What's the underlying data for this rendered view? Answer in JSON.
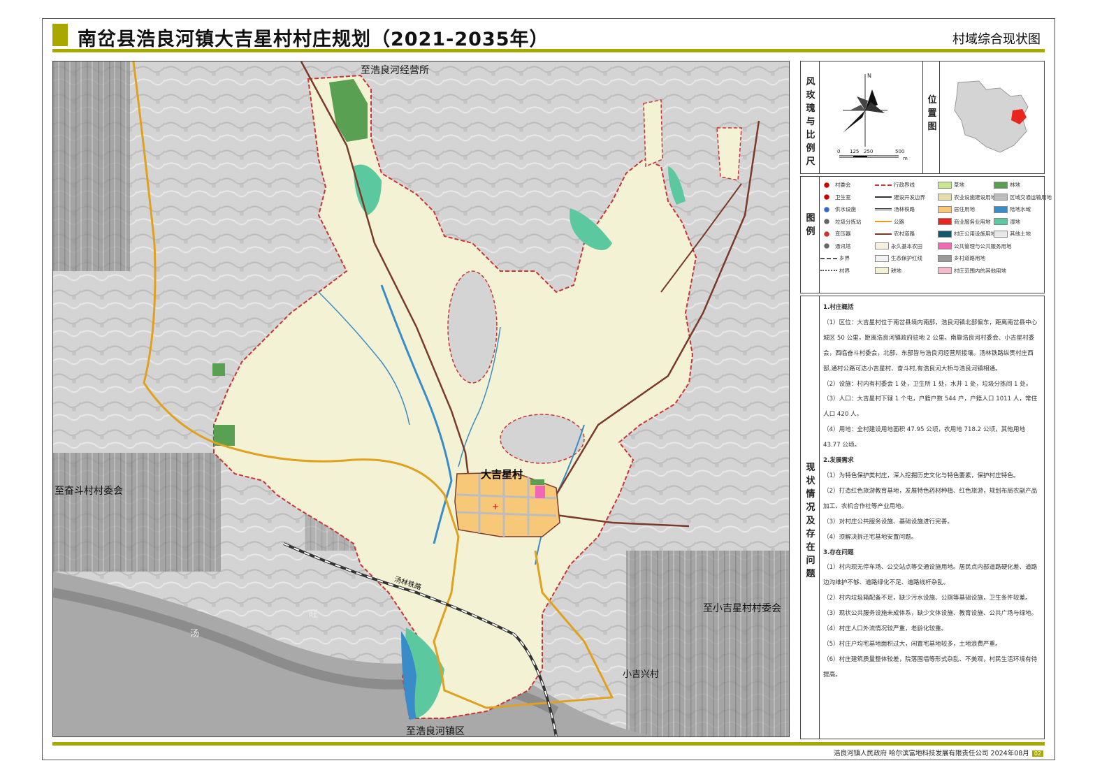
{
  "header": {
    "title": "南岔县浩良河镇大吉星村村庄规划（2021-2035年）",
    "subtitle": "村域综合现状图"
  },
  "map": {
    "labels": {
      "north_top": "至浩良河经营所",
      "west": "至奋斗村村委会",
      "east": "至小吉星村村委会",
      "south": "至浩良河镇区",
      "xiaojixing": "小吉兴村",
      "village": "大吉星村",
      "railway": "汤林铁路",
      "river1": "汤",
      "river2": "旺"
    }
  },
  "compass_panel": {
    "label": "风玫瑰与比例尺",
    "north": "N",
    "scale": [
      "0",
      "125",
      "250",
      "500"
    ],
    "scale_unit": "m"
  },
  "location_panel": {
    "label": "位置图"
  },
  "legend": {
    "label": "图例",
    "items": [
      {
        "text": "村委会",
        "kind": "point",
        "color": "#cc0000"
      },
      {
        "text": "卫生室",
        "kind": "point",
        "color": "#cc0000"
      },
      {
        "text": "供水设施",
        "kind": "point",
        "color": "#3366cc"
      },
      {
        "text": "垃圾分拣站",
        "kind": "point",
        "color": "#666666"
      },
      {
        "text": "变压器",
        "kind": "point",
        "color": "#cc3333"
      },
      {
        "text": "通讯塔",
        "kind": "point",
        "color": "#666666"
      },
      {
        "text": "乡界",
        "kind": "line-dash",
        "color": "#555555"
      },
      {
        "text": "村界",
        "kind": "line-dot",
        "color": "#555555"
      },
      {
        "text": "行政界线",
        "kind": "line-dash",
        "color": "#cc3333"
      },
      {
        "text": "建设开发边界",
        "kind": "line",
        "color": "#333333"
      },
      {
        "text": "汤林铁路",
        "kind": "rail",
        "color": "#333333"
      },
      {
        "text": "公路",
        "kind": "line",
        "color": "#e0a020"
      },
      {
        "text": "农村道路",
        "kind": "line",
        "color": "#7a3a2a"
      },
      {
        "text": "永久基本农田",
        "kind": "fill",
        "color": "#f7f0e0"
      },
      {
        "text": "生态保护红线",
        "kind": "fill",
        "color": "#f2f2f2"
      },
      {
        "text": "耕地",
        "kind": "fill",
        "color": "#f4f2d4"
      },
      {
        "text": "草地",
        "kind": "fill",
        "color": "#c8e88c"
      },
      {
        "text": "农业设施建设用地",
        "kind": "fill",
        "color": "#e6dcaa"
      },
      {
        "text": "居住用地",
        "kind": "fill",
        "color": "#f6c878"
      },
      {
        "text": "商业服务业用地",
        "kind": "fill",
        "color": "#e8261e"
      },
      {
        "text": "村庄公用设施用地",
        "kind": "fill",
        "color": "#0f5a6e"
      },
      {
        "text": "公共管理与公共服务用地",
        "kind": "fill",
        "color": "#f068b4"
      },
      {
        "text": "乡村道路用地",
        "kind": "fill",
        "color": "#999999"
      },
      {
        "text": "村庄范围内的其他用地",
        "kind": "fill",
        "color": "#f4b8c8"
      },
      {
        "text": "林地",
        "kind": "fill",
        "color": "#5aa052"
      },
      {
        "text": "区域交通运输用地",
        "kind": "fill",
        "color": "#bdbdbd"
      },
      {
        "text": "陆地水域",
        "kind": "fill",
        "color": "#3a8cc8"
      },
      {
        "text": "湿地",
        "kind": "fill",
        "color": "#5cc8a0"
      },
      {
        "text": "其他土地",
        "kind": "fill",
        "color": "#e8e8e8"
      }
    ]
  },
  "description": {
    "label": "现状情况及存在问题",
    "paragraphs": [
      {
        "type": "h",
        "text": "1.村庄概括"
      },
      {
        "type": "p",
        "text": "（1）区位：大吉星村位于南岔县境内南部，浩良河镇北部偏东，距离南岔县中心城区 50 公里，距离浩良河镇政府驻地 2 公里。南靠浩良河村委会、小吉星村委会，西临奋斗村委会，北部、东部皆与浩良河经营所接壤。汤林铁路纵贯村庄西部,通村公路可达小吉星村、奋斗村,有浩良河大桥与浩良河镇相通。"
      },
      {
        "type": "p",
        "text": "（2）设施：村内有村委会 1 处，卫生所 1 处，水井 1 处，垃圾分拣间 1 处。"
      },
      {
        "type": "p",
        "text": "（3）人口：大吉星村下辖 1 个屯，户籍户数 544 户，户籍人口 1011 人，常住人口 420 人。"
      },
      {
        "type": "p",
        "text": "（4）用地：全村建设用地面积 47.95 公顷，农用地 718.2 公顷，其他用地 43.77 公顷。"
      },
      {
        "type": "h",
        "text": "2.发展需求"
      },
      {
        "type": "p",
        "text": "（1）为特色保护类村庄，深入挖掘历史文化与特色要素，保护村庄特色。"
      },
      {
        "type": "p",
        "text": "（2）打造红色旅游教育基地，发展特色药材种植、红色旅游，规划布局农副产品加工、农机合作社等产业用地。"
      },
      {
        "type": "p",
        "text": "（3）对村庄公共服务设施、基础设施进行完善。"
      },
      {
        "type": "p",
        "text": "（4）须解决拆迁宅基地安置问题。"
      },
      {
        "type": "h",
        "text": "3.存在问题"
      },
      {
        "type": "p",
        "text": "（1）村内现无停车场、公交站点等交通设施用地。居民点内部道路硬化差、道路边沟维护不够、道路绿化不足、道路线杆杂乱。"
      },
      {
        "type": "p",
        "text": "（2）村内垃圾箱配备不足，缺少污水设施、公厕等基础设施，卫生条件较差。"
      },
      {
        "type": "p",
        "text": "（3）现状公共服务设施未成体系，缺少文体设施、教育设施、公共广场与绿地。"
      },
      {
        "type": "p",
        "text": "（4）村庄人口外流情况较严重，老龄化较重。"
      },
      {
        "type": "p",
        "text": "（5）村庄户均宅基地面积过大，闲置宅基地较多，土地浪费严重。"
      },
      {
        "type": "p",
        "text": "（6）村庄建筑质量整体较差，院落围墙等形式杂乱、不美观，村民生活环境有待提高。"
      }
    ]
  },
  "footer": {
    "text": "浩良河镇人民政府  哈尔滨富地科技发展有限责任公司  2024年08月",
    "page": "02"
  },
  "colors": {
    "accent": "#a8a800",
    "farmland": "#f4f2d4",
    "forest": "#5aa052",
    "wetland": "#5cc8a0",
    "water": "#3a8cc8",
    "road": "#e0a020",
    "village_road": "#7a3a2a",
    "boundary": "#cc3333",
    "residential": "#f6c878"
  }
}
